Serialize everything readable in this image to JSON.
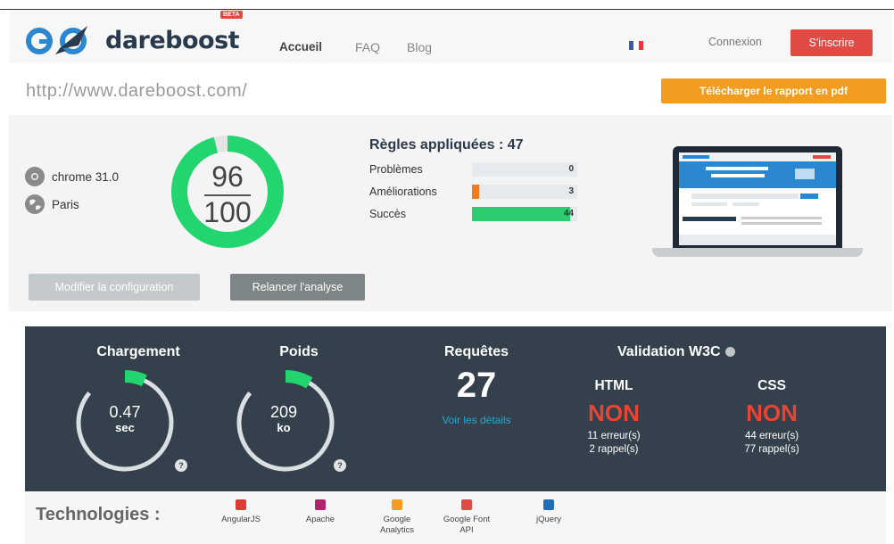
{
  "header": {
    "brand": "dareboost",
    "beta_badge": "BETA",
    "nav": [
      {
        "label": "Accueil",
        "active": true
      },
      {
        "label": "FAQ",
        "active": false
      },
      {
        "label": "Blog",
        "active": false
      }
    ],
    "flag_colors": [
      "#3b5aa8",
      "#ffffff",
      "#e0393e"
    ],
    "login_label": "Connexion",
    "signup_label": "S'inscrire"
  },
  "urlbar": {
    "url": "http://www.dareboost.com/",
    "pdf_button": "Télécharger le rapport en pdf"
  },
  "summary": {
    "browser": "chrome 31.0",
    "location": "Paris",
    "score": {
      "value": "96",
      "max": "100",
      "ratio": 0.96,
      "color": "#23d56e"
    },
    "rules_title": "Règles appliquées : 47",
    "rules": [
      {
        "label": "Problèmes",
        "count": "0",
        "fraction": 0.0,
        "color": "#e14a45"
      },
      {
        "label": "Améliorations",
        "count": "3",
        "fraction": 0.064,
        "color": "#f07c22"
      },
      {
        "label": "Succès",
        "count": "44",
        "fraction": 0.936,
        "color": "#2ecc71"
      }
    ],
    "config_button": "Modifier la configuration",
    "relaunch_button": "Relancer l'analyse"
  },
  "metrics": {
    "loading": {
      "title": "Chargement",
      "value": "0.47",
      "unit": "sec",
      "fraction": 0.08
    },
    "weight": {
      "title": "Poids",
      "value": "209",
      "unit": "ko",
      "fraction": 0.1
    },
    "requests": {
      "title": "Requêtes",
      "count": "27",
      "details_link": "Voir les détails"
    },
    "w3c": {
      "title": "Validation W3C",
      "html": {
        "label": "HTML",
        "status": "NON",
        "errors": "11 erreur(s)",
        "reminders": "2 rappel(s)"
      },
      "css": {
        "label": "CSS",
        "status": "NON",
        "errors": "44 erreur(s)",
        "reminders": "77 rappel(s)"
      }
    },
    "accent_color": "#23d56e",
    "error_color": "#e84434"
  },
  "technologies": {
    "title": "Technologies :",
    "items": [
      {
        "name": "AngularJS",
        "icon": "angularjs-icon",
        "color": "#dd3b33"
      },
      {
        "name": "Apache",
        "icon": "apache-icon",
        "color": "#b0246e"
      },
      {
        "name": "Google Analytics",
        "icon": "google-analytics-icon",
        "color": "#f39c1f"
      },
      {
        "name": "Google Font API",
        "icon": "google-font-icon",
        "color": "#e14a45"
      },
      {
        "name": "jQuery",
        "icon": "jquery-icon",
        "color": "#1f6fb8"
      }
    ]
  }
}
